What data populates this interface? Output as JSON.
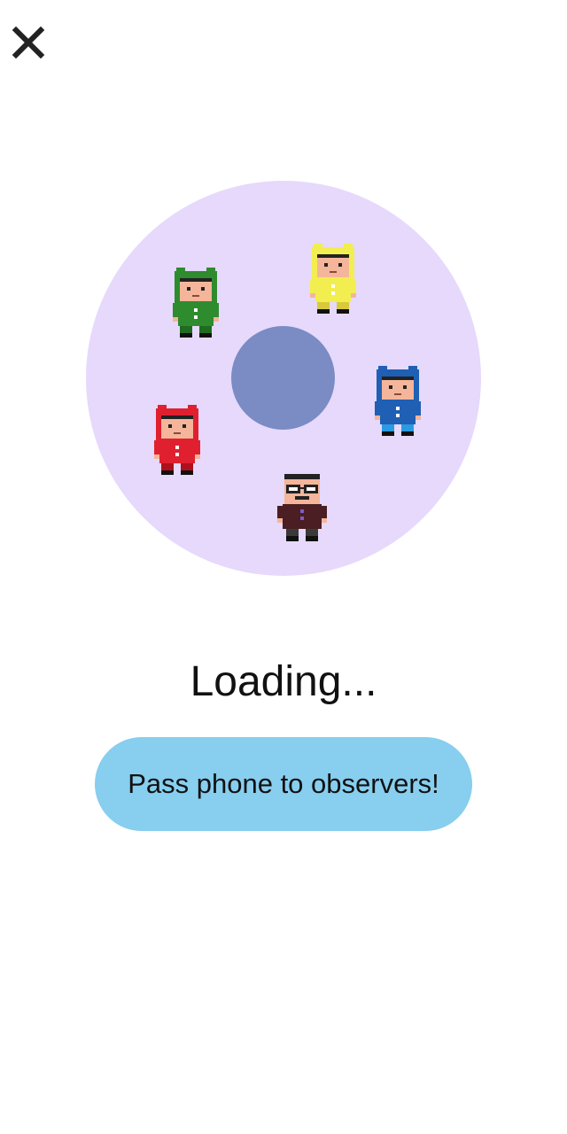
{
  "header": {
    "close_icon": "close-icon"
  },
  "wheel": {
    "outer_color": "#E6D9FC",
    "center_color": "#7B8BC4"
  },
  "characters": [
    {
      "name": "green-frog-character",
      "hood": "#2E8B2E",
      "body": "#2E8B2E",
      "accent": "#1F6B1F"
    },
    {
      "name": "yellow-character",
      "hood": "#F2EE50",
      "body": "#F2EE50",
      "accent": "#D8C93A"
    },
    {
      "name": "blue-character",
      "hood": "#1F5FB4",
      "body": "#1F5FB4",
      "accent": "#2A9BE0"
    },
    {
      "name": "red-character",
      "hood": "#E0202F",
      "body": "#E0202F",
      "accent": "#B0101C"
    },
    {
      "name": "glasses-man-character",
      "hood": "#222222",
      "body": "#4A1E22",
      "accent": "#7B5CC4"
    }
  ],
  "status": {
    "loading_text": "Loading..."
  },
  "action": {
    "pass_phone_label": "Pass phone to observers!",
    "button_color": "#87CEEF"
  }
}
